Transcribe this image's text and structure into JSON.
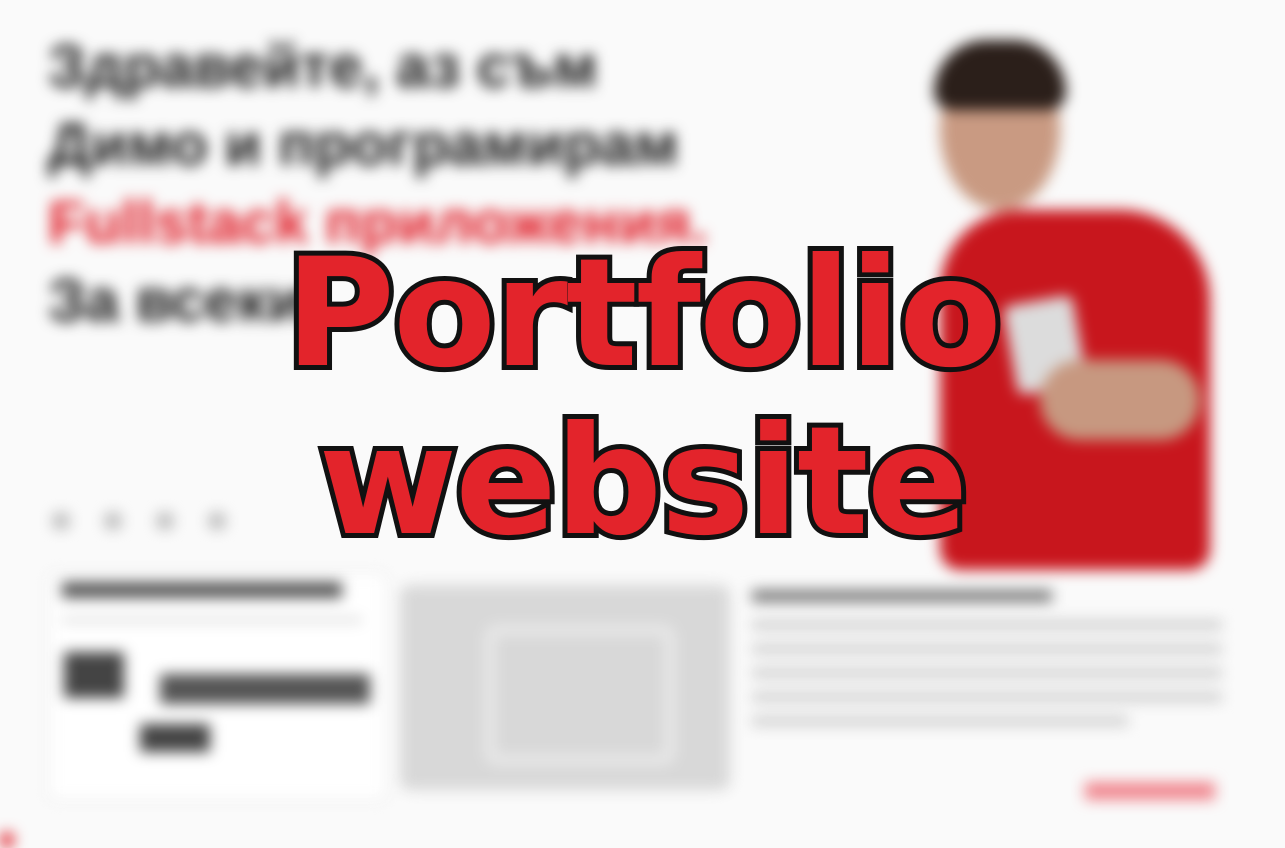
{
  "background": {
    "hero_lines": [
      "Здравейте, аз съм",
      "Димо и програмирам",
      "Fullstack приложения.",
      "За всеки"
    ],
    "accent_color": "#e0202a",
    "shirt_color": "#c8161d",
    "page_background": "#fafafa",
    "image_placeholder_icon": "image-icon"
  },
  "overlay": {
    "line1": "Portfolio",
    "line2": "website",
    "fill_color": "#e3242b",
    "stroke_color": "#111111"
  }
}
